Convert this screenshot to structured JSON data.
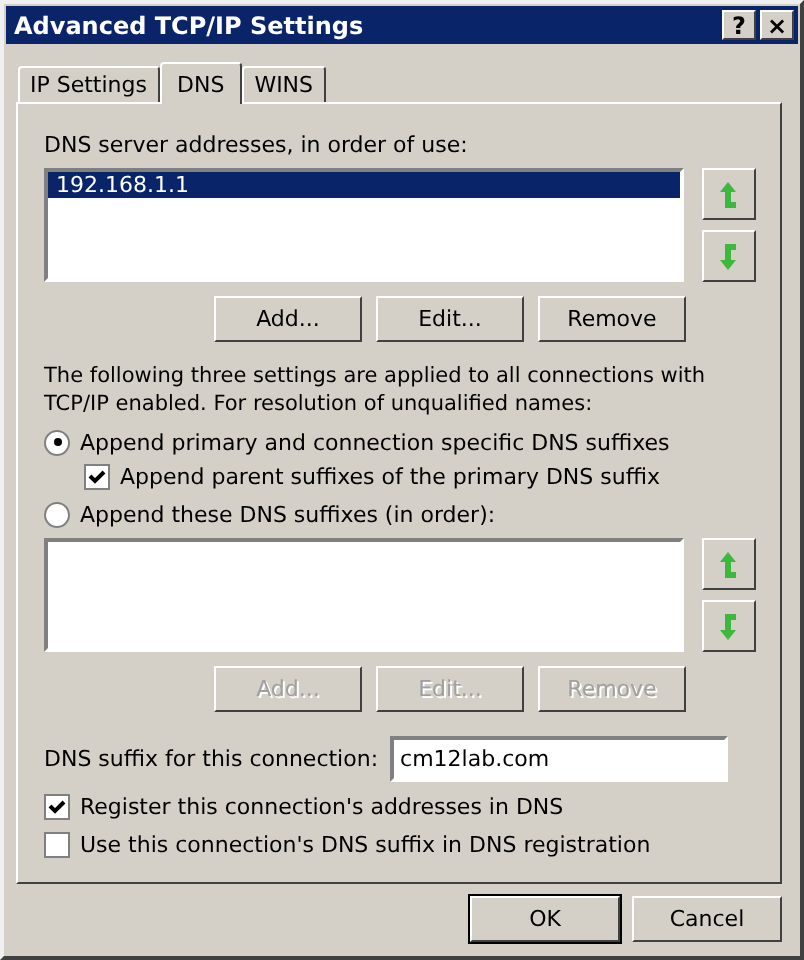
{
  "window": {
    "title": "Advanced TCP/IP Settings",
    "title_buttons": [
      "?",
      "×"
    ]
  },
  "tabs": [
    {
      "label": "IP Settings",
      "selected": false
    },
    {
      "label": "DNS",
      "selected": true
    },
    {
      "label": "WINS",
      "selected": false
    }
  ],
  "dns_servers": {
    "label": "DNS server addresses, in order of use:",
    "items": [
      {
        "text": "192.168.1.1",
        "selected": true
      }
    ],
    "buttons": [
      {
        "label": "Add...",
        "disabled": false
      },
      {
        "label": "Edit...",
        "disabled": false
      },
      {
        "label": "Remove",
        "disabled": false
      }
    ]
  },
  "resolution_note": "The following three settings are applied to all connections with TCP/IP enabled. For resolution of unqualified names:",
  "options": [
    {
      "kind": "radio",
      "label": "Append primary and connection specific DNS suffixes",
      "selected": true,
      "children": [
        {
          "kind": "checkbox",
          "label": "Append parent suffixes of the primary DNS suffix",
          "checked": true
        }
      ]
    },
    {
      "kind": "radio",
      "label": "Append these DNS suffixes (in order):",
      "selected": false
    }
  ],
  "suffix_list": {
    "buttons": [
      {
        "label": "Add...",
        "disabled": true
      },
      {
        "label": "Edit...",
        "disabled": true
      },
      {
        "label": "Remove",
        "disabled": true
      }
    ]
  },
  "connection_suffix": {
    "label": "DNS suffix for this connection:",
    "value": "cm12lab.com"
  },
  "registration": [
    {
      "label": "Register this connection's addresses in DNS",
      "checked": true
    },
    {
      "label": "Use this connection's DNS suffix in DNS registration",
      "checked": false
    }
  ],
  "footer_buttons": [
    {
      "label": "OK",
      "default": true
    },
    {
      "label": "Cancel",
      "default": false
    }
  ]
}
